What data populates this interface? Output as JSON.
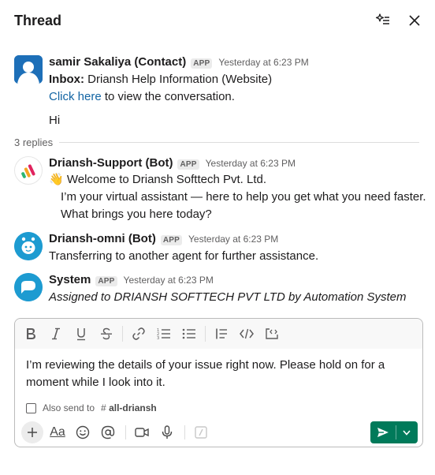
{
  "header": {
    "title": "Thread"
  },
  "messages": [
    {
      "sender": "samir Sakaliya (Contact)",
      "badge": "APP",
      "time": "Yesterday at 6:23 PM",
      "inbox_label": "Inbox:",
      "inbox_value": " Driansh Help Information (Website)",
      "link_text": "Click here",
      "link_suffix": " to view the conversation.",
      "body": "Hi"
    },
    {
      "sender": "Driansh-Support (Bot)",
      "badge": "APP",
      "time": "Yesterday at 6:23 PM",
      "line1": "👋 Welcome to Driansh Softtech Pvt. Ltd.",
      "line2": "I’m your virtual assistant — here to help you get what you need faster.",
      "line3": "What brings you here today?"
    },
    {
      "sender": "Driansh-omni (Bot)",
      "badge": "APP",
      "time": "Yesterday at 6:23 PM",
      "body": "Transferring to another agent for further assistance."
    },
    {
      "sender": "System",
      "badge": "APP",
      "time": "Yesterday at 6:23 PM",
      "body": "Assigned to DRIANSH SOFTTECH PVT LTD by Automation System"
    }
  ],
  "replies": {
    "label": "3 replies"
  },
  "composer": {
    "draft": "I’m reviewing the details of your issue right now. Please hold on for a moment while I look into it.",
    "also_send_label": "Also send to",
    "channel_hash": "#",
    "channel_name": "all-driansh",
    "format_label": "Aa"
  },
  "colors": {
    "accent_link": "#1264a3",
    "send_button": "#007a5a",
    "avatar_blue": "#1d9bd1"
  }
}
